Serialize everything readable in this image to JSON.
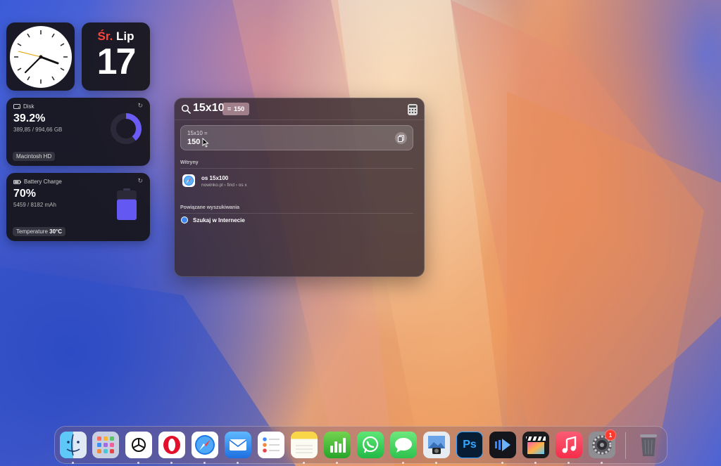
{
  "calendar_widget": {
    "weekday": "Śr.",
    "month": "Lip",
    "day": "17"
  },
  "disk_widget": {
    "title": "Disk",
    "percent": "39.2%",
    "usage": "389,85 / 994,66 GB",
    "drive_label": "Macintosh HD",
    "used_fraction": 0.392
  },
  "battery_widget": {
    "title": "Battery Charge",
    "percent": "70%",
    "capacity": "5459 / 8182 mAh",
    "temp_label": "Temperature",
    "temp_value": "30°C",
    "charge_fraction": 0.7
  },
  "spotlight": {
    "query": "15x10",
    "inline_result_eq": "=",
    "inline_result": "150",
    "calc_expression": "15x10 =",
    "calc_value": "150",
    "sites_header": "Witryny",
    "site_title": "os 15x100",
    "site_path": "nowinko.pl › find › os x",
    "related_header": "Powiązane wyszukiwania",
    "web_search_label": "Szukaj w Internecie"
  },
  "dock": {
    "items": [
      "Finder",
      "Launchpad",
      "ChatGPT",
      "Opera",
      "Safari",
      "Mail",
      "Reminders",
      "Notes",
      "Numbers",
      "WhatsApp",
      "Messages",
      "Preview",
      "Photoshop",
      "Infuse",
      "Final Cut Pro",
      "Music",
      "System Settings",
      "Trash"
    ],
    "settings_badge": "1",
    "photoshop_label": "Ps"
  }
}
